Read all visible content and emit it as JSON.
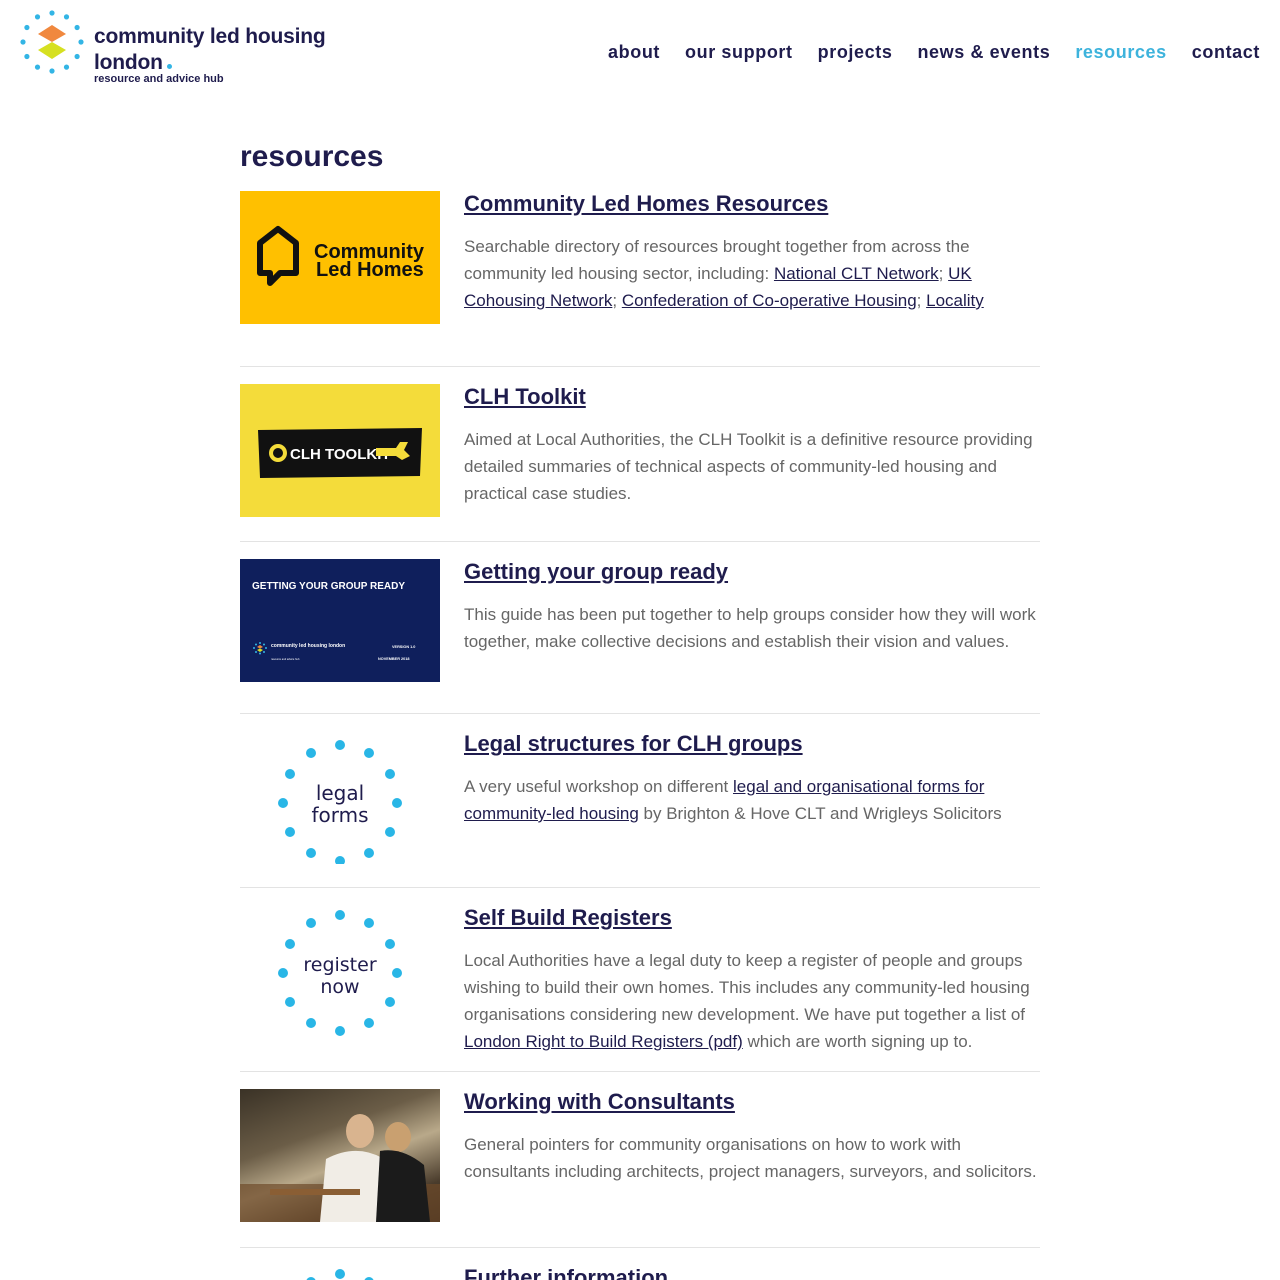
{
  "header": {
    "logo_title": "community led housing london",
    "logo_subtitle": "resource and advice hub",
    "nav": [
      {
        "label": "about"
      },
      {
        "label": "our support"
      },
      {
        "label": "projects"
      },
      {
        "label": "news & events"
      },
      {
        "label": "resources",
        "active": true
      },
      {
        "label": "contact"
      }
    ]
  },
  "page": {
    "title": "resources"
  },
  "resources": [
    {
      "title": "Community Led Homes Resources",
      "thumb_text": [
        "Community",
        "Led Homes"
      ],
      "desc_prefix": "Searchable directory of resources brought together from across the community led housing sector, including: ",
      "links": [
        "National CLT Network",
        "UK Cohousing Network",
        "Confederation of Co-operative Housing",
        "Locality"
      ],
      "separator": "; "
    },
    {
      "title": "CLH Toolkit",
      "thumb_text": "CLH TOOLKIT",
      "desc": "Aimed at Local Authorities, the CLH Toolkit is a definitive resource providing detailed summaries of technical aspects of community-led housing and practical case studies."
    },
    {
      "title": "Getting your group ready",
      "thumb_heading": "GETTING YOUR GROUP READY",
      "thumb_org": "community led housing london",
      "thumb_org_sub": "resource and advice hub",
      "thumb_version": "VERSION 1.0",
      "thumb_date": "NOVEMBER 2018",
      "desc": "This guide has been put together to help groups consider how they will work together, make collective decisions and establish their vision and values."
    },
    {
      "title": "Legal structures for CLH groups",
      "thumb_text": [
        "legal",
        "forms"
      ],
      "desc_prefix": "A very useful workshop on different ",
      "link": "legal and organisational forms for community-led housing",
      "desc_suffix": " by Brighton & Hove CLT and Wrigleys Solicitors"
    },
    {
      "title": "Self Build Registers",
      "thumb_text": [
        "register",
        "now"
      ],
      "desc_prefix": "Local Authorities have a legal duty to keep a register of people and groups wishing to build their own homes. This includes any community-led housing organisations considering new development. We have put together a list of ",
      "link": "London Right to Build Registers (pdf)",
      "desc_suffix": " which are worth signing up to."
    },
    {
      "title": "Working with Consultants",
      "desc": "General pointers for community organisations on how to work with consultants including architects, project managers, surveyors, and solicitors."
    },
    {
      "title": "Further information"
    }
  ],
  "colors": {
    "navy": "#1f1c4d",
    "accent": "#3db3dc",
    "text_muted": "#666666",
    "clh_yellow": "#ffc000",
    "toolkit_yellow": "#f4dc3a",
    "guide_navy": "#0f1f5c"
  }
}
